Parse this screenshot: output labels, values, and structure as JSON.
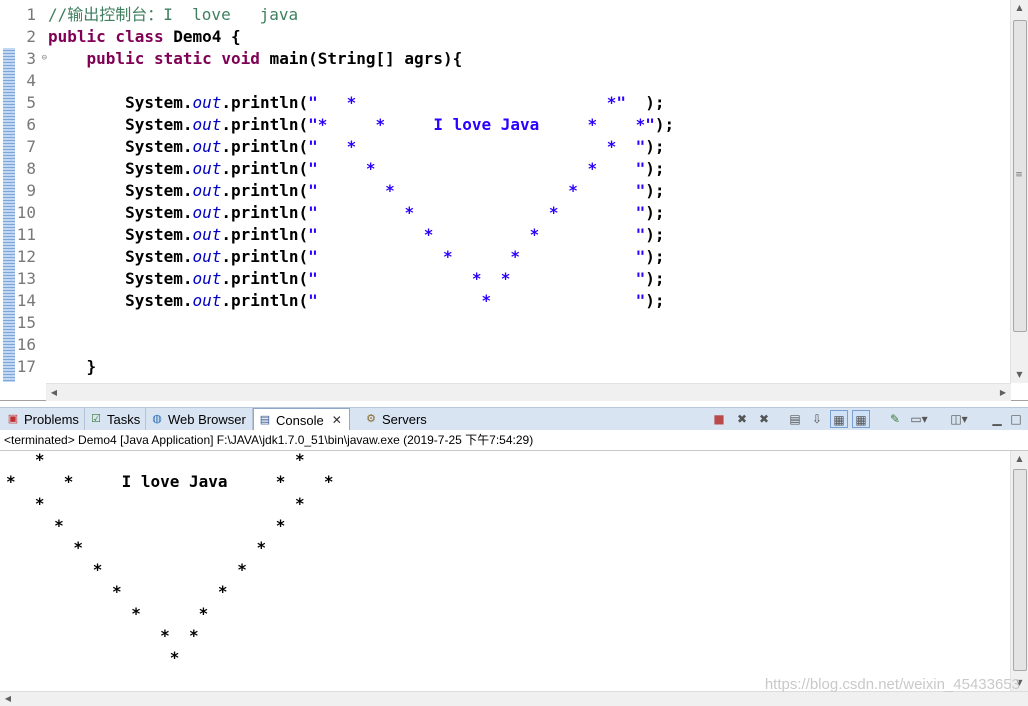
{
  "editor": {
    "line_numbers": [
      "1",
      "2",
      "3",
      "4",
      "5",
      "6",
      "7",
      "8",
      "9",
      "10",
      "11",
      "12",
      "13",
      "14",
      "15",
      "16",
      "17"
    ],
    "lines": [
      {
        "c1": "//输出控制台：I  love   java"
      },
      {
        "k1": "public class",
        "t1": " Demo4 {"
      },
      {
        "pre": "    ",
        "k1": "public static void",
        "t1": " main(String[] agrs){"
      },
      {
        "t1": ""
      },
      {
        "pre": "        System.",
        "f": "out",
        "mid": ".println(",
        "s": "\"   *                          *\"",
        "post": "  );"
      },
      {
        "pre": "        System.",
        "f": "out",
        "mid": ".println(",
        "s": "\"*     *     I love Java     *    *\"",
        "post": ");"
      },
      {
        "pre": "        System.",
        "f": "out",
        "mid": ".println(",
        "s": "\"   *                          *  \"",
        "post": ");"
      },
      {
        "pre": "        System.",
        "f": "out",
        "mid": ".println(",
        "s": "\"     *                      *    \"",
        "post": ");"
      },
      {
        "pre": "        System.",
        "f": "out",
        "mid": ".println(",
        "s": "\"       *                  *      \"",
        "post": ");"
      },
      {
        "pre": "        System.",
        "f": "out",
        "mid": ".println(",
        "s": "\"         *              *        \"",
        "post": ");"
      },
      {
        "pre": "        System.",
        "f": "out",
        "mid": ".println(",
        "s": "\"           *          *          \"",
        "post": ");"
      },
      {
        "pre": "        System.",
        "f": "out",
        "mid": ".println(",
        "s": "\"             *      *            \"",
        "post": ");"
      },
      {
        "pre": "        System.",
        "f": "out",
        "mid": ".println(",
        "s": "\"                *  *             \"",
        "post": ");"
      },
      {
        "pre": "        System.",
        "f": "out",
        "mid": ".println(",
        "s": "\"                 *               \"",
        "post": ");"
      },
      {
        "t1": ""
      },
      {
        "t1": ""
      },
      {
        "t1": "    }"
      }
    ]
  },
  "view": {
    "tabs": [
      {
        "label": "Problems",
        "icon": "problems-icon"
      },
      {
        "label": "Tasks",
        "icon": "tasks-icon"
      },
      {
        "label": "Web Browser",
        "icon": "web-browser-icon"
      },
      {
        "label": "Console",
        "icon": "console-icon",
        "close": "✕"
      },
      {
        "label": "Servers",
        "icon": "servers-icon"
      }
    ],
    "toolbar_icons": [
      "terminate-icon",
      "remove-launch-icon",
      "remove-all-icon",
      "clear-console-icon",
      "scroll-lock-icon",
      "show-stdout-icon",
      "show-stderr-icon",
      "pin-console-icon",
      "display-console-icon",
      "open-console-icon",
      "minimize-icon",
      "maximize-icon"
    ]
  },
  "console": {
    "header": "<terminated> Demo4 [Java Application] F:\\JAVA\\jdk1.7.0_51\\bin\\javaw.exe (2019-7-25 下午7:54:29)",
    "output": [
      "   *                          *",
      "*     *     I love Java     *    *",
      "   *                          *  ",
      "     *                      *    ",
      "       *                  *      ",
      "         *              *        ",
      "           *          *          ",
      "             *      *            ",
      "                *  *             ",
      "                 *               "
    ]
  },
  "watermark": "https://blog.csdn.net/weixin_45433653"
}
